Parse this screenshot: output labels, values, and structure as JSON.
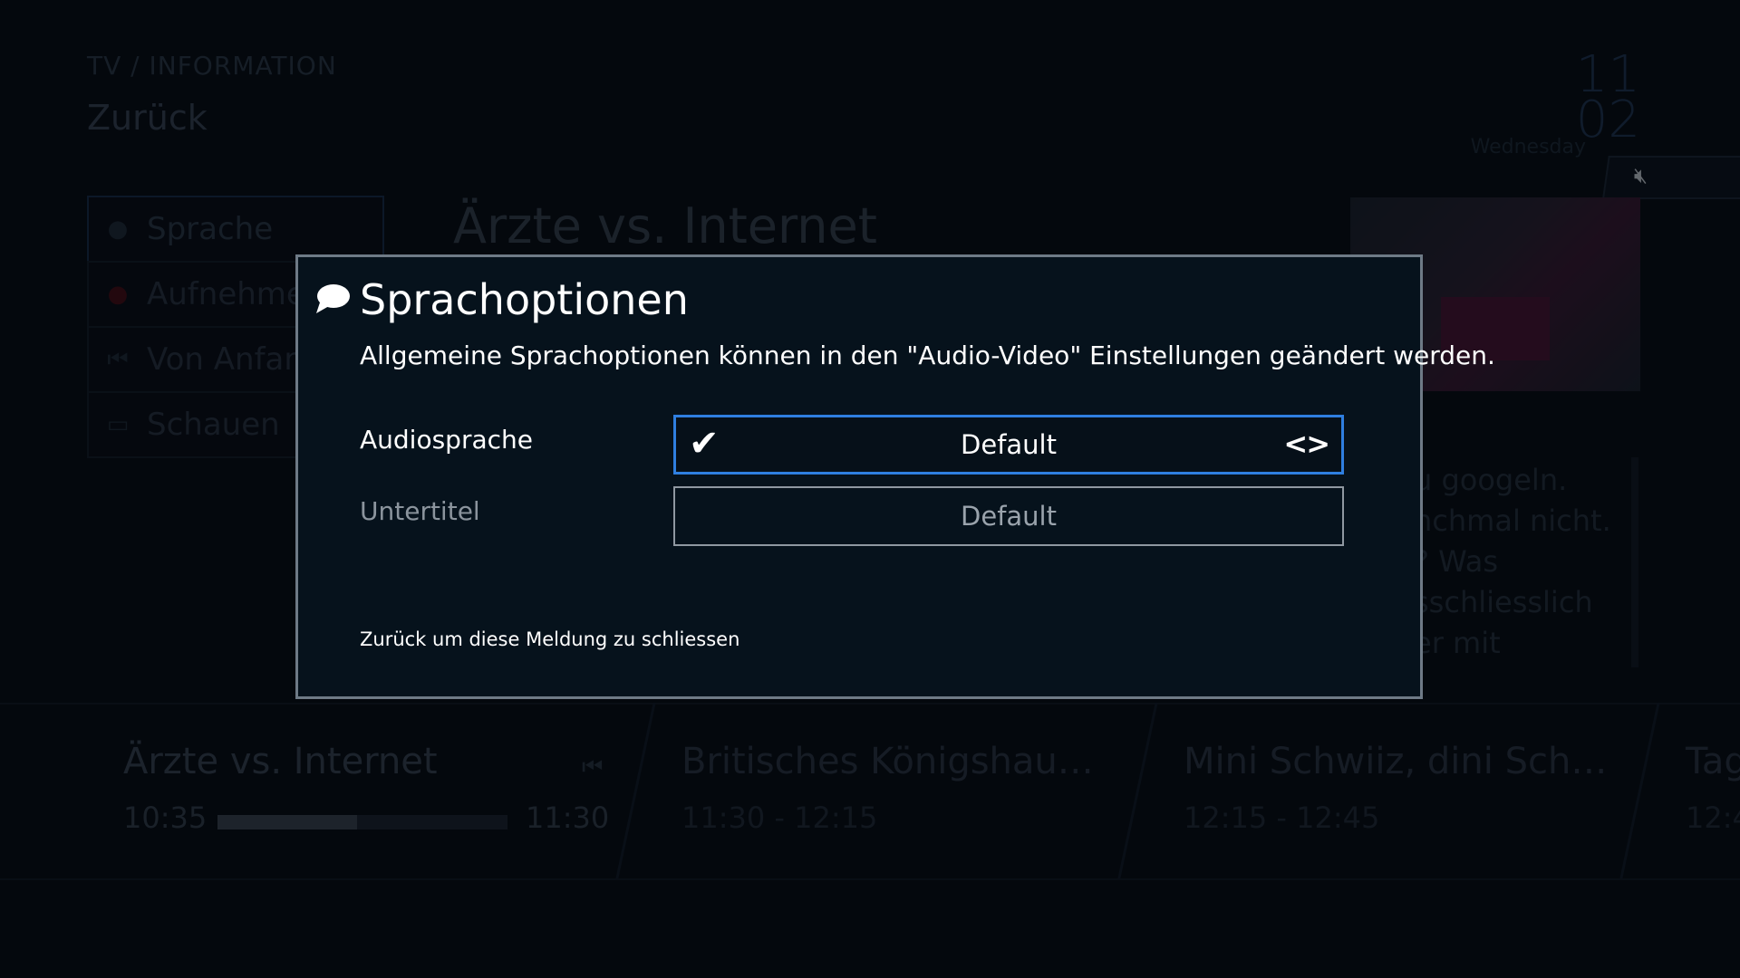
{
  "header": {
    "breadcrumb": "TV / INFORMATION",
    "back_label": "Zurück",
    "clock_hours": "11",
    "clock_minutes": "02",
    "weekday": "Wednesday"
  },
  "side_menu": {
    "items": [
      {
        "label": "Sprache",
        "icon": "speech-bubble-icon"
      },
      {
        "label": "Aufnehmen",
        "icon": "record-dot-icon"
      },
      {
        "label": "Von Anfang",
        "icon": "restart-icon"
      },
      {
        "label": "Schauen",
        "icon": "tv-icon"
      }
    ]
  },
  "show": {
    "title": "Ärzte vs. Internet",
    "description_fragments": [
      "u googeln.",
      "nchmal nicht.",
      "? Was",
      "sschliesslich",
      "er mit"
    ]
  },
  "epg": {
    "current": {
      "title": "Ärzte vs. Internet",
      "start": "10:35",
      "end": "11:30",
      "progress": 0.48
    },
    "next": [
      {
        "title": "Britisches Königshau…",
        "time": "11:30 - 12:15"
      },
      {
        "title": "Mini Schwiiz, dini Sch…",
        "time": "12:15 - 12:45"
      },
      {
        "title": "Tag",
        "time": "12:4"
      }
    ]
  },
  "dialog": {
    "title": "Sprachoptionen",
    "subtitle": "Allgemeine Sprachoptionen können in den \"Audio-Video\" Einstellungen geändert werden.",
    "audio_label": "Audiosprache",
    "audio_value": "Default",
    "subtitle_label": "Untertitel",
    "subtitle_value": "Default",
    "footer": "Zurück um diese Meldung zu schliessen"
  },
  "colors": {
    "accent": "#2f7fe0",
    "dialog_bg": "#06121c",
    "dialog_border": "#6e7a86"
  }
}
